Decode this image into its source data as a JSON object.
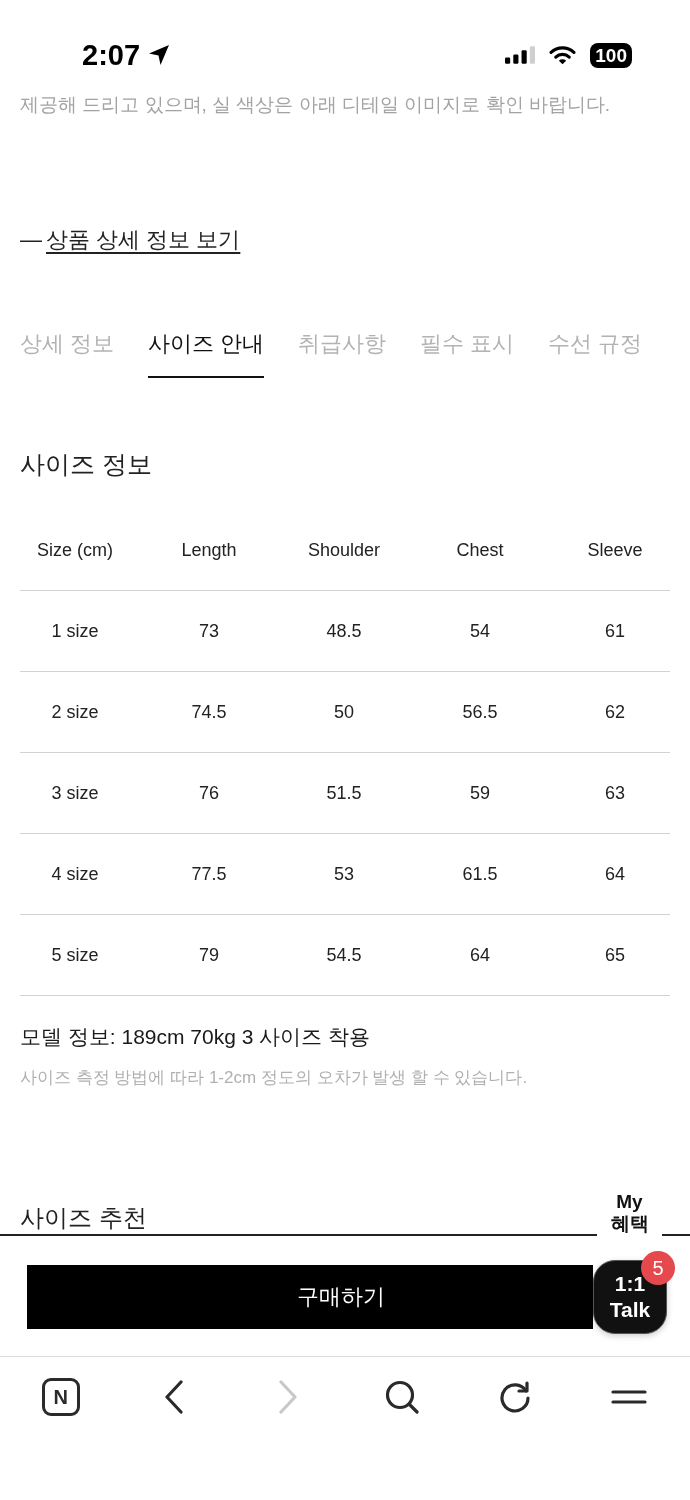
{
  "status_bar": {
    "time": "2:07",
    "battery": "100"
  },
  "intro_text": "제공해 드리고 있으며, 실 색상은 아래 디테일 이미지로 확인 바랍니다.",
  "detail_link": {
    "prefix": "—",
    "label": "상품 상세 정보 보기"
  },
  "tabs": [
    {
      "label": "상세 정보",
      "selected": false
    },
    {
      "label": "사이즈 안내",
      "selected": true
    },
    {
      "label": "취급사항",
      "selected": false
    },
    {
      "label": "필수 표시",
      "selected": false
    },
    {
      "label": "수선 규정",
      "selected": false
    }
  ],
  "size_info": {
    "title": "사이즈 정보",
    "table": {
      "columns": [
        "Size (cm)",
        "Length",
        "Shoulder",
        "Chest",
        "Sleeve"
      ],
      "rows": [
        [
          "1 size",
          "73",
          "48.5",
          "54",
          "61"
        ],
        [
          "2 size",
          "74.5",
          "50",
          "56.5",
          "62"
        ],
        [
          "3 size",
          "76",
          "51.5",
          "59",
          "63"
        ],
        [
          "4 size",
          "77.5",
          "53",
          "61.5",
          "64"
        ],
        [
          "5 size",
          "79",
          "54.5",
          "64",
          "65"
        ]
      ]
    },
    "model_info": "모델 정보: 189cm 70kg 3 사이즈 착용",
    "note": "사이즈 측정 방법에 따라 1-2cm 정도의 오차가 발생 할 수 있습니다."
  },
  "size_recommendation": {
    "title": "사이즈 추천"
  },
  "my_benefits_button": "My 혜택",
  "buy_button": "구매하기",
  "talk_button": {
    "label": "1:1 Talk",
    "badge": "5"
  },
  "browser_toolbar": [
    {
      "kind": "logo",
      "label": "N",
      "disabled": false
    },
    {
      "kind": "back",
      "disabled": false
    },
    {
      "kind": "forward",
      "disabled": true
    },
    {
      "kind": "search",
      "disabled": false
    },
    {
      "kind": "reload",
      "disabled": false
    },
    {
      "kind": "menu",
      "disabled": false
    }
  ]
}
